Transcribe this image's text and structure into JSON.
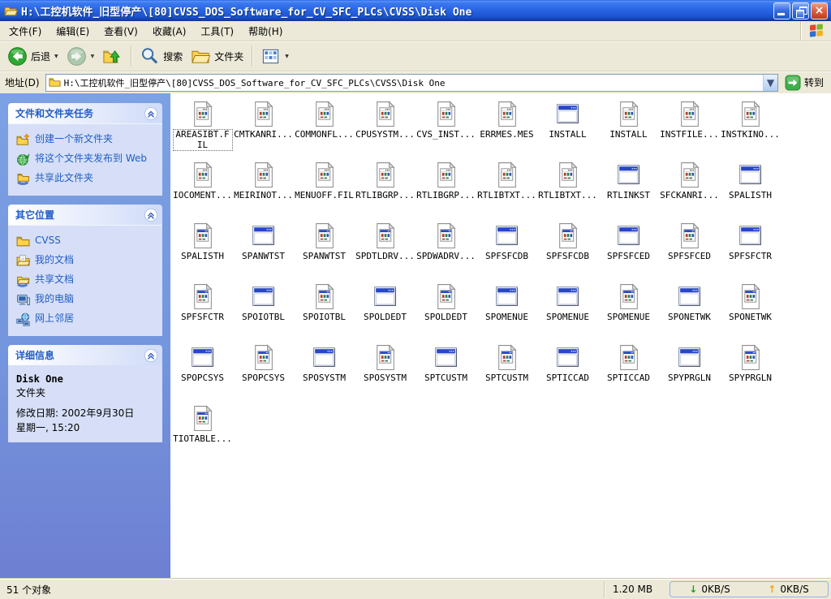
{
  "window": {
    "title": "H:\\工控机软件_旧型停产\\[80]CVSS_DOS_Software_for_CV_SFC_PLCs\\CVSS\\Disk One"
  },
  "menu": {
    "items": [
      "文件(F)",
      "编辑(E)",
      "查看(V)",
      "收藏(A)",
      "工具(T)",
      "帮助(H)"
    ]
  },
  "toolbar": {
    "back": "后退",
    "search": "搜索",
    "folders": "文件夹"
  },
  "address_bar": {
    "label": "地址(D)",
    "value": "H:\\工控机软件_旧型停产\\[80]CVSS_DOS_Software_for_CV_SFC_PLCs\\CVSS\\Disk One",
    "go_label": "转到"
  },
  "sidebar": {
    "tasks_panel": {
      "title": "文件和文件夹任务",
      "items": [
        {
          "icon": "new-folder-icon",
          "label": "创建一个新文件夹"
        },
        {
          "icon": "publish-web-icon",
          "label": "将这个文件夹发布到 Web"
        },
        {
          "icon": "share-folder-icon",
          "label": "共享此文件夹"
        }
      ]
    },
    "places_panel": {
      "title": "其它位置",
      "items": [
        {
          "icon": "folder-icon",
          "label": "CVSS"
        },
        {
          "icon": "my-documents-icon",
          "label": "我的文档"
        },
        {
          "icon": "shared-documents-icon",
          "label": "共享文档"
        },
        {
          "icon": "my-computer-icon",
          "label": "我的电脑"
        },
        {
          "icon": "network-places-icon",
          "label": "网上邻居"
        }
      ]
    },
    "details_panel": {
      "title": "详细信息",
      "name": "Disk One",
      "type": "文件夹",
      "modified_line1": "修改日期: 2002年9月30日",
      "modified_line2": "星期一, 15:20"
    }
  },
  "files": [
    {
      "label": "AREASIBT.FIL",
      "type": "document-icon",
      "selected": true
    },
    {
      "label": "CMTKANRI...",
      "type": "document-icon"
    },
    {
      "label": "COMMONFL...",
      "type": "document-icon"
    },
    {
      "label": "CPUSYSTM...",
      "type": "document-icon"
    },
    {
      "label": "CVS_INST...",
      "type": "document-icon"
    },
    {
      "label": "ERRMES.MES",
      "type": "document-icon"
    },
    {
      "label": "INSTALL",
      "type": "application-window-icon"
    },
    {
      "label": "INSTALL",
      "type": "document-icon"
    },
    {
      "label": "INSTFILE...",
      "type": "document-icon"
    },
    {
      "label": "INSTKINO...",
      "type": "document-icon"
    },
    {
      "label": "IOCOMENT...",
      "type": "document-icon"
    },
    {
      "label": "MEIRINOT...",
      "type": "document-icon"
    },
    {
      "label": "MENUOFF.FIL",
      "type": "document-icon"
    },
    {
      "label": "RTLIBGRP...",
      "type": "document-icon"
    },
    {
      "label": "RTLIBGRP...",
      "type": "document-icon"
    },
    {
      "label": "RTLIBTXT...",
      "type": "document-icon"
    },
    {
      "label": "RTLIBTXT...",
      "type": "document-icon"
    },
    {
      "label": "RTLINKST",
      "type": "application-window-icon"
    },
    {
      "label": "SFCKANRI...",
      "type": "document-icon"
    },
    {
      "label": "SPALISTH",
      "type": "application-window-icon"
    },
    {
      "label": "SPALISTH",
      "type": "document-blue-icon"
    },
    {
      "label": "SPANWTST",
      "type": "application-window-icon"
    },
    {
      "label": "SPANWTST",
      "type": "document-blue-icon"
    },
    {
      "label": "SPDTLDRV...",
      "type": "document-blue-icon"
    },
    {
      "label": "SPDWADRV...",
      "type": "document-blue-icon"
    },
    {
      "label": "SPFSFCDB",
      "type": "application-window-icon"
    },
    {
      "label": "SPFSFCDB",
      "type": "document-blue-icon"
    },
    {
      "label": "SPFSFCED",
      "type": "application-window-icon"
    },
    {
      "label": "SPFSFCED",
      "type": "document-blue-icon"
    },
    {
      "label": "SPFSFCTR",
      "type": "application-window-icon"
    },
    {
      "label": "SPFSFCTR",
      "type": "document-blue-icon"
    },
    {
      "label": "SPOIOTBL",
      "type": "application-window-icon"
    },
    {
      "label": "SPOIOTBL",
      "type": "document-blue-icon"
    },
    {
      "label": "SPOLDEDT",
      "type": "application-window-icon"
    },
    {
      "label": "SPOLDEDT",
      "type": "document-blue-icon"
    },
    {
      "label": "SPOMENUE",
      "type": "application-window-icon"
    },
    {
      "label": "SPOMENUE",
      "type": "application-window-icon"
    },
    {
      "label": "SPOMENUE",
      "type": "document-blue-icon"
    },
    {
      "label": "SPONETWK",
      "type": "application-window-icon"
    },
    {
      "label": "SPONETWK",
      "type": "document-blue-icon"
    },
    {
      "label": "SPOPCSYS",
      "type": "application-window-icon"
    },
    {
      "label": "SPOPCSYS",
      "type": "document-blue-icon"
    },
    {
      "label": "SPOSYSTM",
      "type": "application-window-icon"
    },
    {
      "label": "SPOSYSTM",
      "type": "document-blue-icon"
    },
    {
      "label": "SPTCUSTM",
      "type": "application-window-icon"
    },
    {
      "label": "SPTCUSTM",
      "type": "document-blue-icon"
    },
    {
      "label": "SPTICCAD",
      "type": "application-window-icon"
    },
    {
      "label": "SPTICCAD",
      "type": "document-blue-icon"
    },
    {
      "label": "SPYPRGLN",
      "type": "application-window-icon"
    },
    {
      "label": "SPYPRGLN",
      "type": "document-blue-icon"
    },
    {
      "label": "TIOTABLE...",
      "type": "document-blue-icon"
    }
  ],
  "status_bar": {
    "objects": "51 个对象",
    "size": "1.20 MB",
    "download": "0KB/S",
    "upload": "0KB/S"
  }
}
